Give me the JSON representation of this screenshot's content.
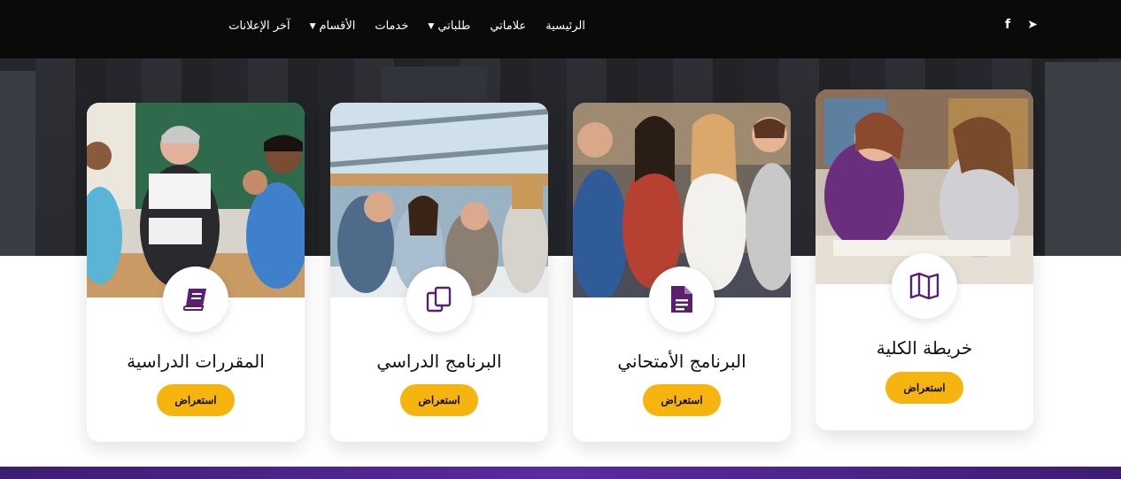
{
  "nav": {
    "items": [
      {
        "label": "الرئيسية",
        "dropdown": false
      },
      {
        "label": "علاماتي",
        "dropdown": false
      },
      {
        "label": "طلباتي",
        "dropdown": true
      },
      {
        "label": "خدمات",
        "dropdown": false
      },
      {
        "label": "الأقسام",
        "dropdown": true
      },
      {
        "label": "آخر الإعلانات",
        "dropdown": false
      }
    ],
    "social": {
      "facebook_glyph": "f",
      "telegram_glyph": "➤"
    }
  },
  "cards": [
    {
      "title": "خريطة الكلية",
      "button": "استعراض",
      "icon": "map-icon"
    },
    {
      "title": "البرنامج الأمتحاني",
      "button": "استعراض",
      "icon": "document-icon"
    },
    {
      "title": "البرنامج الدراسي",
      "button": "استعراض",
      "icon": "copy-icon"
    },
    {
      "title": "المقررات الدراسية",
      "button": "استعراض",
      "icon": "book-icon"
    }
  ],
  "colors": {
    "accent": "#f6b40f",
    "icon": "#5a1f6e",
    "nav_bg": "#0a0a0a",
    "footer": "#4b2490"
  }
}
